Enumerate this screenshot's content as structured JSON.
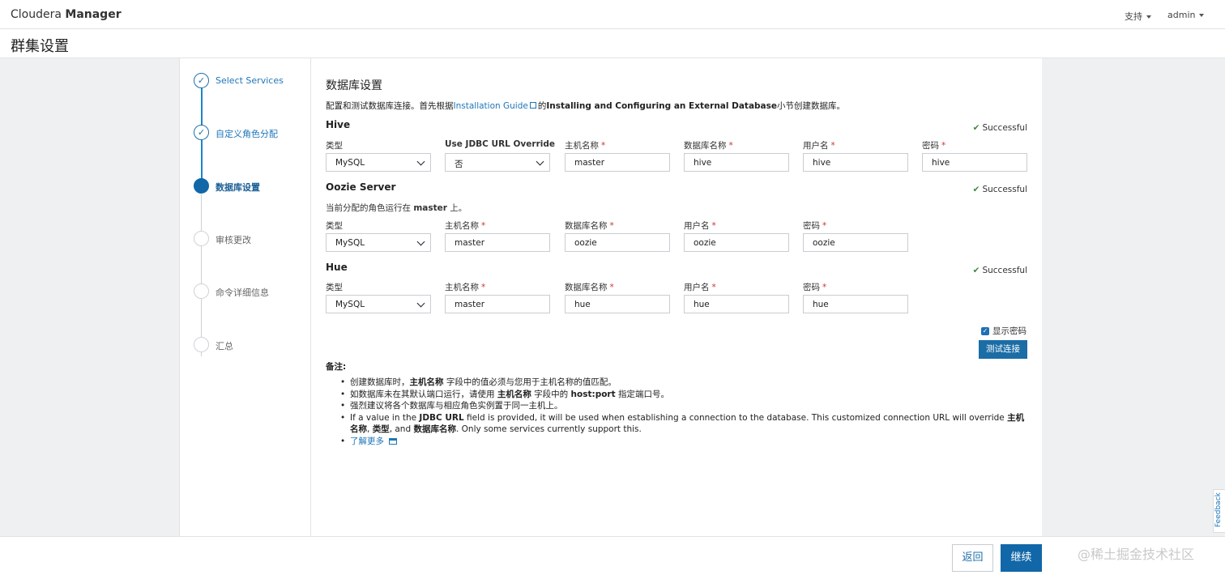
{
  "header": {
    "brand_prefix": "Cloudera ",
    "brand_bold": "Manager",
    "support": "支持",
    "user": "admin"
  },
  "page_title": "群集设置",
  "steps": [
    {
      "label": "Select Services",
      "state": "done"
    },
    {
      "label": "自定义角色分配",
      "state": "done"
    },
    {
      "label": "数据库设置",
      "state": "current"
    },
    {
      "label": "审核更改",
      "state": "todo"
    },
    {
      "label": "命令详细信息",
      "state": "todo"
    },
    {
      "label": "汇总",
      "state": "todo"
    }
  ],
  "main": {
    "title": "数据库设置",
    "intro_before": "配置和测试数据库连接。首先根据",
    "intro_link": "Installation Guide",
    "intro_mid": "的",
    "intro_bold": "Installing and Configuring an External Database",
    "intro_after": "小节创建数据库。"
  },
  "labels": {
    "type": "类型",
    "jdbc": "Use JDBC URL Override",
    "host": "主机名称",
    "dbname": "数据库名称",
    "user": "用户名",
    "password": "密码",
    "required": "*",
    "successful": "Successful"
  },
  "hive": {
    "name": "Hive",
    "type": "MySQL",
    "jdbc": "否",
    "host": "master",
    "dbname": "hive",
    "user": "hive",
    "password": "hive"
  },
  "oozie": {
    "name": "Oozie Server",
    "note_before": "当前分配的角色运行在 ",
    "note_bold": "master",
    "note_after": " 上。",
    "type": "MySQL",
    "host": "master",
    "dbname": "oozie",
    "user": "oozie",
    "password": "oozie"
  },
  "hue": {
    "name": "Hue",
    "type": "MySQL",
    "host": "master",
    "dbname": "hue",
    "user": "hue",
    "password": "hue"
  },
  "show_password": "显示密码",
  "test_button": "测试连接",
  "notes": {
    "heading": "备注:",
    "n1_a": "创建数据库时，",
    "n1_b": "主机名称",
    "n1_c": " 字段中的值必须与您用于主机名称的值匹配。",
    "n2_a": "如数据库未在其默认端口运行，请使用 ",
    "n2_b": "主机名称",
    "n2_c": " 字段中的 ",
    "n2_d": "host:port",
    "n2_e": " 指定端口号。",
    "n3": "强烈建议将各个数据库与相应角色实例置于同一主机上。",
    "n4_a": "If a value in the ",
    "n4_b": "JDBC URL",
    "n4_c": " field is provided, it will be used when establishing a connection to the database. This customized connection URL will override ",
    "n4_d": "主机名称",
    "n4_e": ", ",
    "n4_f": "类型",
    "n4_g": ", and ",
    "n4_h": "数据库名称",
    "n4_i": ". Only some services currently support this.",
    "learn_more": "了解更多"
  },
  "footer": {
    "back": "返回",
    "next": "继续",
    "watermark": "@稀土掘金技术社区"
  },
  "feedback": "Feedback",
  "colors": {
    "accent": "#1167a8",
    "link": "#1f76b8",
    "success": "#3c8a3c",
    "required": "#cc3333"
  }
}
